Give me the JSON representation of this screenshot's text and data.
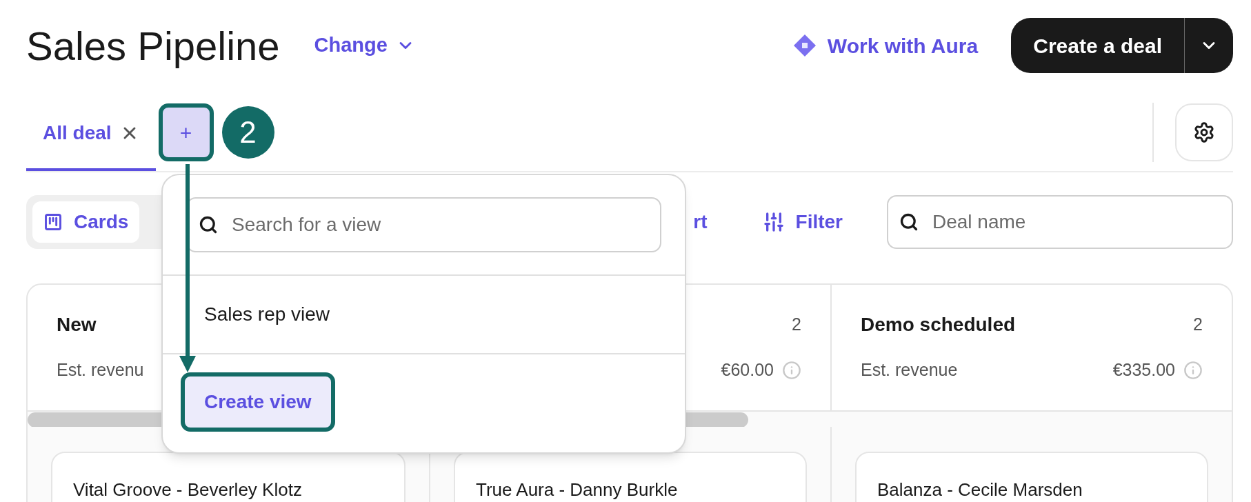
{
  "header": {
    "title": "Sales Pipeline",
    "change_label": "Change",
    "aura_label": "Work with Aura",
    "create_label": "Create a deal"
  },
  "tabs": [
    {
      "label": "All deal",
      "selected": true
    }
  ],
  "add_view_button": {
    "label": "+",
    "highlighted": true
  },
  "annotation": {
    "step": "2"
  },
  "toolbar": {
    "views": [
      {
        "label": "Cards",
        "selected": true
      }
    ],
    "sort_label": "rt",
    "filter_label": "Filter",
    "search_placeholder": "Deal name"
  },
  "columns": [
    {
      "title": "New",
      "revenue_label": "Est. revenu",
      "cards": [
        {
          "title": "Vital Groove - Beverley Klotz"
        }
      ]
    },
    {
      "count": "2",
      "revenue": "€60.00",
      "cards": [
        {
          "title": "True Aura - Danny Burkle"
        }
      ]
    },
    {
      "title": "Demo scheduled",
      "count": "2",
      "revenue_label": "Est. revenue",
      "revenue": "€335.00",
      "cards": [
        {
          "title": "Balanza - Cecile Marsden"
        }
      ]
    }
  ],
  "popover": {
    "search_placeholder": "Search for a view",
    "items": [
      {
        "label": "Sales rep view"
      }
    ],
    "create_label": "Create view",
    "create_highlighted": true
  }
}
